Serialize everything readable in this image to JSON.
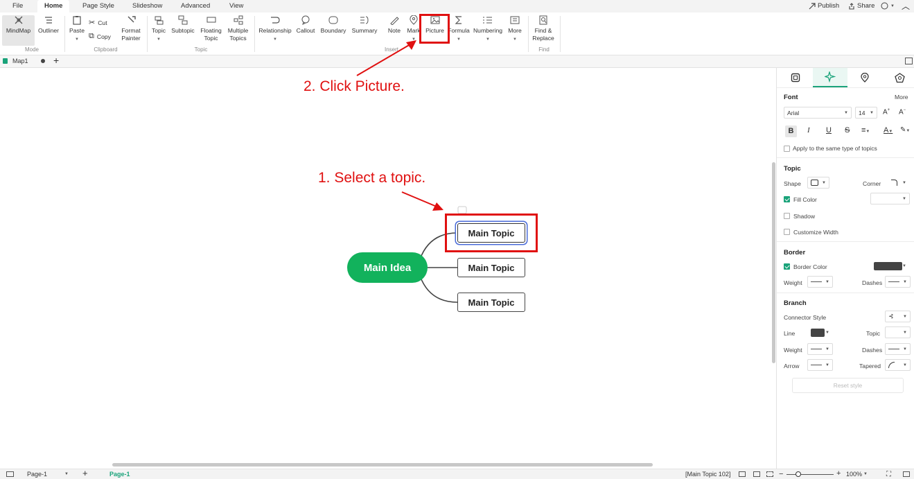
{
  "menu": {
    "tabs": [
      "File",
      "Home",
      "Page Style",
      "Slideshow",
      "Advanced",
      "View"
    ],
    "active": "Home",
    "publish": "Publish",
    "share": "Share",
    "help": "?"
  },
  "ribbon": {
    "mindmap": "MindMap",
    "outliner": "Outliner",
    "mode_group": "Mode",
    "paste": "Paste",
    "cut": "Cut",
    "copy": "Copy",
    "format_painter": "Format Painter",
    "clipboard_group": "Clipboard",
    "topic": "Topic",
    "subtopic": "Subtopic",
    "floating_topic": "Floating Topic",
    "multiple_topics": "Multiple Topics",
    "topic_group": "Topic",
    "relationship": "Relationship",
    "callout": "Callout",
    "boundary": "Boundary",
    "summary": "Summary",
    "note": "Note",
    "mark": "Mark",
    "picture": "Picture",
    "formula": "Formula",
    "numbering": "Numbering",
    "more": "More",
    "insert_group": "Insert",
    "find_replace": "Find & Replace",
    "find_group": "Find"
  },
  "doc": {
    "tab_name": "Map1"
  },
  "canvas": {
    "main_idea": "Main Idea",
    "topics": [
      "Main Topic",
      "Main Topic",
      "Main Topic"
    ],
    "annotation_1": "1. Select a topic.",
    "annotation_2": "2. Click Picture."
  },
  "panel": {
    "font_heading": "Font",
    "more": "More",
    "font_family": "Arial",
    "font_size": "14",
    "apply_same": "Apply to the same type of topics",
    "topic_heading": "Topic",
    "shape": "Shape",
    "corner": "Corner",
    "fill_color": "Fill Color",
    "shadow": "Shadow",
    "customize_width": "Customize Width",
    "border_heading": "Border",
    "border_color": "Border Color",
    "weight": "Weight",
    "dashes": "Dashes",
    "branch_heading": "Branch",
    "connector_style": "Connector Style",
    "line": "Line",
    "topic": "Topic",
    "arrow": "Arrow",
    "tapered": "Tapered",
    "reset_style": "Reset style",
    "fill_checked": true,
    "border_checked": true
  },
  "status": {
    "page_select": "Page-1",
    "page_tab": "Page-1",
    "selection": "[Main Topic 102]",
    "zoom": "100%"
  },
  "colors": {
    "accent": "#1aa37a",
    "main_idea": "#12b25c",
    "annotation": "#e01010",
    "selection": "#4a6bd8"
  }
}
